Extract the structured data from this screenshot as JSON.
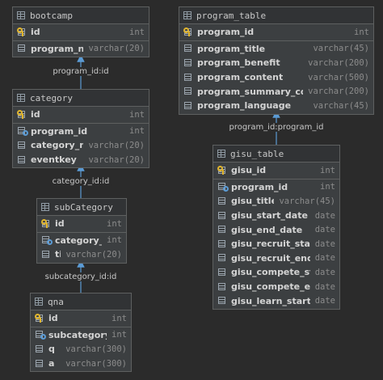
{
  "tables": {
    "bootcamp": {
      "name": "bootcamp",
      "pk": [
        {
          "name": "id",
          "type": "int",
          "icon": "primary-key-icon"
        }
      ],
      "rows": [
        {
          "name": "program_name",
          "type": "varchar(20)",
          "icon": "column-icon"
        }
      ]
    },
    "category": {
      "name": "category",
      "pk": [
        {
          "name": "id",
          "type": "int",
          "icon": "primary-key-icon"
        }
      ],
      "rows": [
        {
          "name": "program_id",
          "type": "int",
          "icon": "foreign-key-icon"
        },
        {
          "name": "category_name",
          "type": "varchar(20)",
          "icon": "column-icon"
        },
        {
          "name": "eventkey",
          "type": "varchar(20)",
          "icon": "column-icon"
        }
      ]
    },
    "subCategory": {
      "name": "subCategory",
      "pk": [
        {
          "name": "id",
          "type": "int",
          "icon": "primary-key-icon"
        }
      ],
      "rows": [
        {
          "name": "category_id",
          "type": "int",
          "icon": "foreign-key-icon"
        },
        {
          "name": "title",
          "type": "varchar(20)",
          "icon": "column-icon"
        }
      ]
    },
    "qna": {
      "name": "qna",
      "pk": [
        {
          "name": "id",
          "type": "int",
          "icon": "primary-key-icon"
        }
      ],
      "rows": [
        {
          "name": "subcategory_id",
          "type": "int",
          "icon": "foreign-key-icon"
        },
        {
          "name": "q",
          "type": "varchar(300)",
          "icon": "column-icon"
        },
        {
          "name": "a",
          "type": "varchar(300)",
          "icon": "column-icon"
        }
      ]
    },
    "program_table": {
      "name": "program_table",
      "pk": [
        {
          "name": "program_id",
          "type": "int",
          "icon": "primary-key-icon"
        }
      ],
      "rows": [
        {
          "name": "program_title",
          "type": "varchar(45)",
          "icon": "column-icon"
        },
        {
          "name": "program_benefit",
          "type": "varchar(200)",
          "icon": "column-icon"
        },
        {
          "name": "program_content",
          "type": "varchar(500)",
          "icon": "column-icon"
        },
        {
          "name": "program_summary_content",
          "type": "varchar(200)",
          "icon": "column-icon"
        },
        {
          "name": "program_language",
          "type": "varchar(45)",
          "icon": "column-icon"
        }
      ]
    },
    "gisu_table": {
      "name": "gisu_table",
      "pk": [
        {
          "name": "gisu_id",
          "type": "int",
          "icon": "primary-key-icon"
        }
      ],
      "rows": [
        {
          "name": "program_id",
          "type": "int",
          "icon": "foreign-key-icon"
        },
        {
          "name": "gisu_title",
          "type": "varchar(45)",
          "icon": "column-icon"
        },
        {
          "name": "gisu_start_date",
          "type": "date",
          "icon": "column-icon"
        },
        {
          "name": "gisu_end_date",
          "type": "date",
          "icon": "column-icon"
        },
        {
          "name": "gisu_recruit_start",
          "type": "date",
          "icon": "column-icon"
        },
        {
          "name": "gisu_recruit_end",
          "type": "date",
          "icon": "column-icon"
        },
        {
          "name": "gisu_compete_start",
          "type": "date",
          "icon": "column-icon"
        },
        {
          "name": "gisu_compete_end",
          "type": "date",
          "icon": "column-icon"
        },
        {
          "name": "gisu_learn_start",
          "type": "date",
          "icon": "column-icon"
        }
      ]
    }
  },
  "links": [
    {
      "label": "program_id:id",
      "from": "category",
      "to": "bootcamp"
    },
    {
      "label": "category_id:id",
      "from": "subCategory",
      "to": "category"
    },
    {
      "label": "subcategory_id:id",
      "from": "qna",
      "to": "subCategory"
    },
    {
      "label": "program_id:program_id",
      "from": "gisu_table",
      "to": "program_table"
    }
  ],
  "colors": {
    "background": "#2b2b2b",
    "link": "#5b9bd5",
    "primary_key": "#e2b62e",
    "foreign_key": "#5b9bd5"
  }
}
